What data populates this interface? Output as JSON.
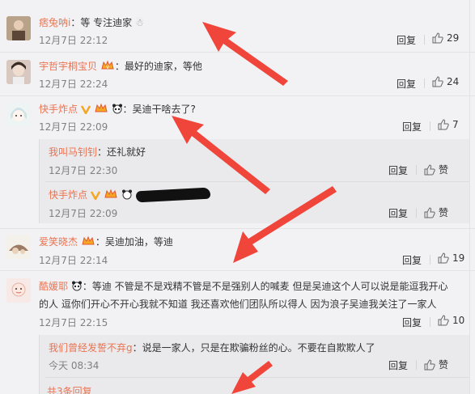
{
  "comments": [
    {
      "user": "痞兔呐i",
      "text": "：等  专注迪家",
      "time": "12月7日 22:12",
      "likes": "29"
    },
    {
      "user": "宇哲宇桐宝贝",
      "text": "：最好的迪家，等他",
      "time": "12月7日 22:24",
      "likes": "24"
    },
    {
      "user": "快手炸点",
      "text": "：吴迪干啥去了?",
      "time": "12月7日 22:09",
      "likes": "7"
    },
    {
      "user": "爱笑晓杰",
      "text": "：吴迪加油，等迪",
      "time": "12月7日 22:14",
      "likes": "19"
    },
    {
      "user": "酷媛耶",
      "text": "：等迪    不管是不是戏精不管是不是强别人的喊麦   但是吴迪这个人可以说是能逗我开心",
      "text2": "的人   逗你们开心不开心我就不知道   我还喜欢他们团队所以得人     因为浪子吴迪我关注了一家人",
      "time": "12月7日 22:15",
      "likes": "10"
    }
  ],
  "subreplies": [
    {
      "user": "我叫马钊钊",
      "text": "：还礼就好",
      "time": "12月7日 22:30"
    },
    {
      "user": "快手炸点",
      "text": "：",
      "time": "12月7日 22:09"
    },
    {
      "user": "我们曾经发誓不弃g",
      "text": "：说是一家人，只是在欺骗粉丝的心。不要在自欺欺人了",
      "time": "今天 08:34"
    }
  ],
  "labels": {
    "reply": "回复",
    "like": "赞",
    "more": "共3条回复"
  },
  "colors": {
    "username": "#eb7350",
    "arrow": "#f0453a"
  }
}
